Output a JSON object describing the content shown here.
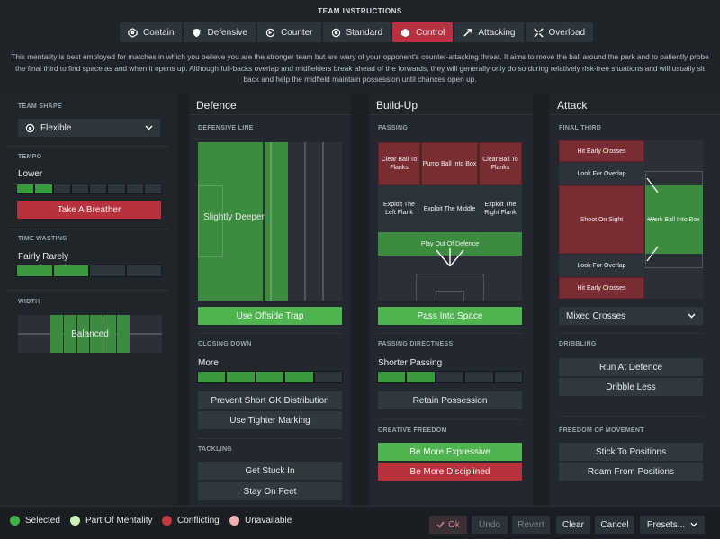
{
  "header": {
    "title": "TEAM INSTRUCTIONS",
    "tabs": [
      {
        "label": "Contain",
        "icon": "contain-icon"
      },
      {
        "label": "Defensive",
        "icon": "shield-icon"
      },
      {
        "label": "Counter",
        "icon": "counter-icon"
      },
      {
        "label": "Standard",
        "icon": "standard-icon"
      },
      {
        "label": "Control",
        "icon": "control-icon",
        "active": true
      },
      {
        "label": "Attacking",
        "icon": "attacking-icon"
      },
      {
        "label": "Overload",
        "icon": "overload-icon"
      }
    ],
    "description": "This mentality is best employed for matches in which you believe you are the stronger team but are wary of your opponent's counter-attacking threat. It aims to move the ball around the park and to patiently probe the final third to find space as and when it opens up. Although full-backs overlap and midfielders break ahead of the forwards, they will generally only do so during relatively risk-free situations and will usually sit back and help the midfield maintain possession until chances open up."
  },
  "left": {
    "team_shape_label": "TEAM SHAPE",
    "team_shape_value": "Flexible",
    "tempo_label": "TEMPO",
    "tempo_value": "Lower",
    "tempo_button": "Take A Breather",
    "tempo_level": 2,
    "time_wasting_label": "TIME WASTING",
    "time_wasting_value": "Fairly Rarely",
    "time_wasting_level": 2,
    "width_label": "WIDTH",
    "width_value": "Balanced"
  },
  "defence": {
    "title": "Defence",
    "defensive_line_label": "DEFENSIVE LINE",
    "defensive_line_value": "Slightly Deeper",
    "offside_button": "Use Offside Trap",
    "closing_down_label": "CLOSING DOWN",
    "closing_down_value": "More",
    "closing_down_level": 4,
    "closing_buttons": [
      "Prevent Short GK Distribution",
      "Use Tighter Marking"
    ],
    "tackling_label": "TACKLING",
    "tackling_buttons": [
      "Get Stuck In",
      "Stay On Feet"
    ]
  },
  "buildup": {
    "title": "Build-Up",
    "passing_label": "PASSING",
    "zones": {
      "top": [
        "Clear Ball To Flanks",
        "Pump Ball Into Box",
        "Clear Ball To Flanks"
      ],
      "mid": [
        "Exploit The Left Flank",
        "Exploit The Middle",
        "Exploit The Right Flank"
      ],
      "bottom": "Play Out Of Defence"
    },
    "pass_space_button": "Pass Into Space",
    "directness_label": "PASSING DIRECTNESS",
    "directness_value": "Shorter Passing",
    "directness_level": 2,
    "retain_button": "Retain Possession",
    "creative_label": "CREATIVE FREEDOM",
    "creative_buttons": [
      "Be More Expressive",
      "Be More Disciplined"
    ]
  },
  "attack": {
    "title": "Attack",
    "final_third_label": "FINAL THIRD",
    "zones": {
      "hit_early_top": "Hit Early Crosses",
      "overlap_top": "Look For Overlap",
      "shoot": "Shoot On Sight",
      "work_ball": "Work Ball Into Box",
      "overlap_bottom": "Look For Overlap",
      "hit_early_bottom": "Hit Early Crosses"
    },
    "crosses_value": "Mixed Crosses",
    "dribbling_label": "DRIBBLING",
    "dribbling_buttons": [
      "Run At Defence",
      "Dribble Less"
    ],
    "freedom_label": "FREEDOM OF MOVEMENT",
    "freedom_buttons": [
      "Stick To Positions",
      "Roam From Positions"
    ]
  },
  "footer": {
    "legend": [
      {
        "label": "Selected",
        "color": "#3fb34a"
      },
      {
        "label": "Part Of Mentality",
        "color": "#c9f5b4"
      },
      {
        "label": "Conflicting",
        "color": "#c03a3f"
      },
      {
        "label": "Unavailable",
        "color": "#f0b2b2"
      }
    ],
    "buttons": {
      "ok": "Ok",
      "undo": "Undo",
      "revert": "Revert",
      "clear": "Clear",
      "cancel": "Cancel",
      "presets": "Presets..."
    }
  }
}
